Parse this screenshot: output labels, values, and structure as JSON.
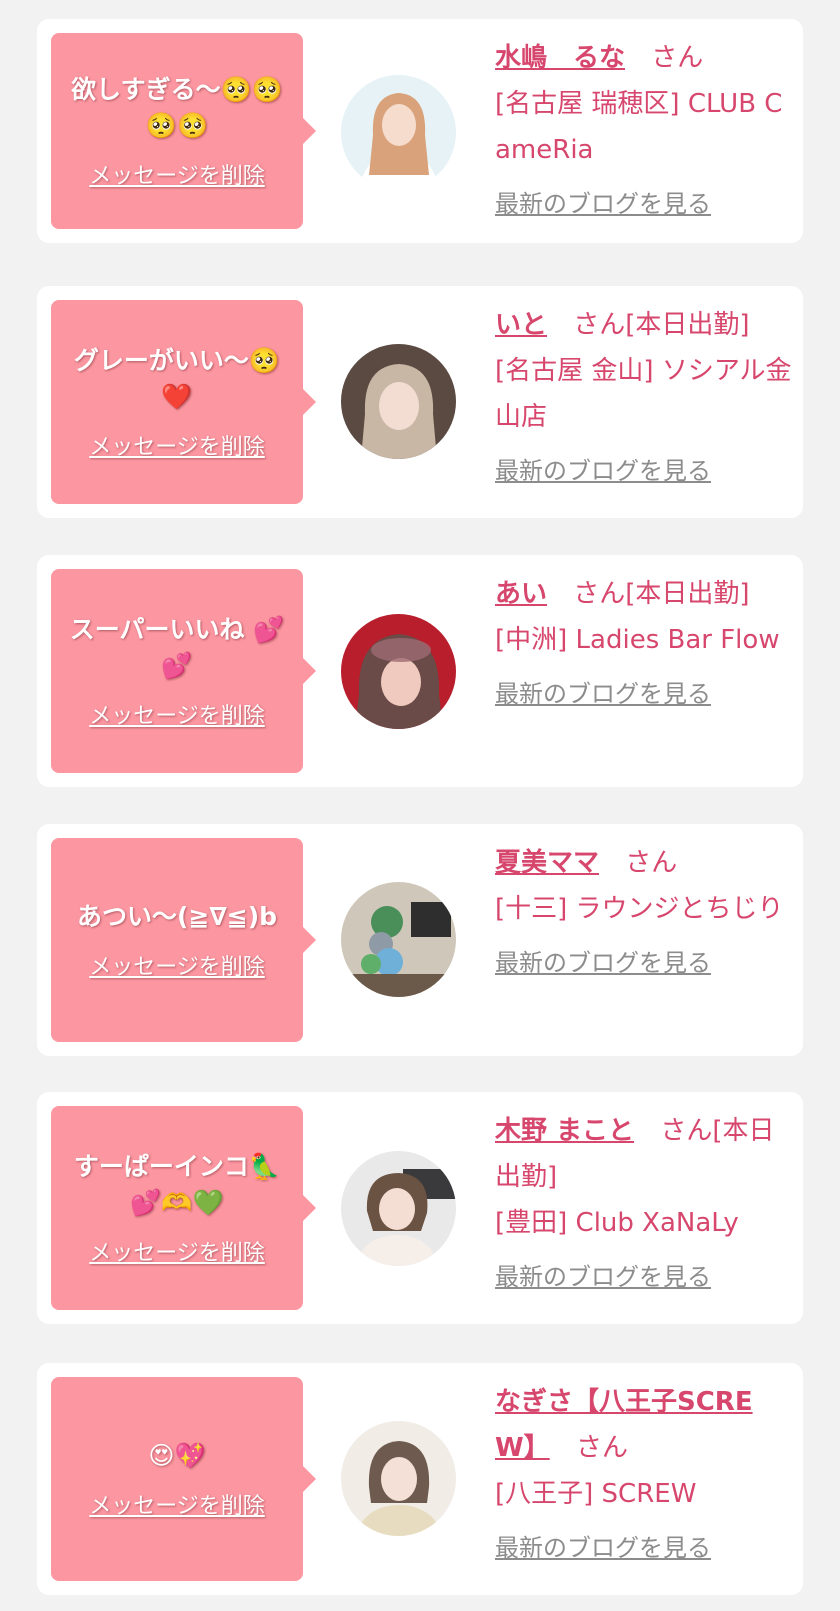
{
  "cards": [
    {
      "message": "欲しすぎる～🥺🥺🥺🥺",
      "delete_label": "メッセージを削除",
      "name": "水嶋　るな",
      "san": "さん",
      "shop": "[名古屋 瑞穂区] CLUB CameRia",
      "blog_label": "最新のブログを見る"
    },
    {
      "message": "グレーがいい～🥺❤️",
      "delete_label": "メッセージを削除",
      "name": "いと",
      "san": "さん[本日出勤]",
      "shop": "[名古屋 金山] ソシアル金山店",
      "blog_label": "最新のブログを見る"
    },
    {
      "message": "スーパーいいね 💕💕",
      "delete_label": "メッセージを削除",
      "name": "あい",
      "san": "さん[本日出勤]",
      "shop": "[中洲] Ladies Bar Flow",
      "blog_label": "最新のブログを見る"
    },
    {
      "message": "あつい～(≧∇≦)b",
      "delete_label": "メッセージを削除",
      "name": "夏美ママ",
      "san": "さん",
      "shop": "[十三] ラウンジとちじり",
      "blog_label": "最新のブログを見る"
    },
    {
      "message": "すーぱーインコ🦜💕🫶💚",
      "delete_label": "メッセージを削除",
      "name": "木野 まこと",
      "san": "さん[本日出勤]",
      "shop": "[豊田] Club XaNaLy",
      "blog_label": "最新のブログを見る"
    },
    {
      "message": "😍💖",
      "delete_label": "メッセージを削除",
      "name": "なぎさ【八王子SCREW】",
      "san": "さん",
      "shop": "[八王子] SCREW",
      "blog_label": "最新のブログを見る"
    }
  ],
  "colors": {
    "accent": "#d7476d",
    "bubble": "#fc97a1",
    "link_gray": "#8c8c8c",
    "background": "#f2f2f2"
  }
}
